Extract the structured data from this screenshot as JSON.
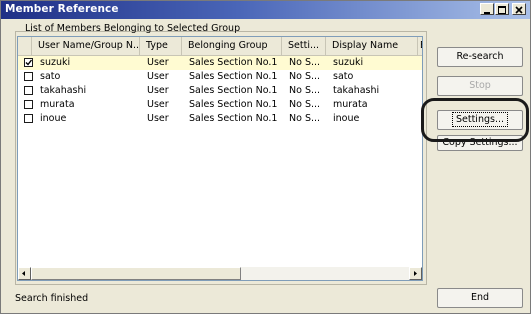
{
  "window": {
    "title": "Member Reference",
    "buttons": {
      "minimize": "minimize-icon",
      "maximize": "maximize-icon",
      "close": "close-icon"
    }
  },
  "group_label": "List of Members Belonging to Selected Group",
  "table": {
    "columns": [
      "User Name/Group N...",
      "Type",
      "Belonging Group",
      "Setti...",
      "Display Name",
      "E"
    ],
    "rows": [
      {
        "checked": true,
        "name": "suzuki",
        "type": "User",
        "group": "Sales Section No.1",
        "setting": "No S...",
        "display": "suzuki"
      },
      {
        "checked": false,
        "name": "sato",
        "type": "User",
        "group": "Sales Section No.1",
        "setting": "No S...",
        "display": "sato"
      },
      {
        "checked": false,
        "name": "takahashi",
        "type": "User",
        "group": "Sales Section No.1",
        "setting": "No S...",
        "display": "takahashi"
      },
      {
        "checked": false,
        "name": "murata",
        "type": "User",
        "group": "Sales Section No.1",
        "setting": "No S...",
        "display": "murata"
      },
      {
        "checked": false,
        "name": "inoue",
        "type": "User",
        "group": "Sales Section No.1",
        "setting": "No S...",
        "display": "inoue"
      }
    ]
  },
  "buttons": {
    "research": "Re-search",
    "stop": "Stop",
    "settings": "Settings...",
    "copy_settings": "Copy Settings...",
    "end": "End"
  },
  "status": "Search finished",
  "colors": {
    "selected_row": "#fffbd2",
    "title_start": "#1f2f86",
    "title_end": "#a9c0e8"
  }
}
